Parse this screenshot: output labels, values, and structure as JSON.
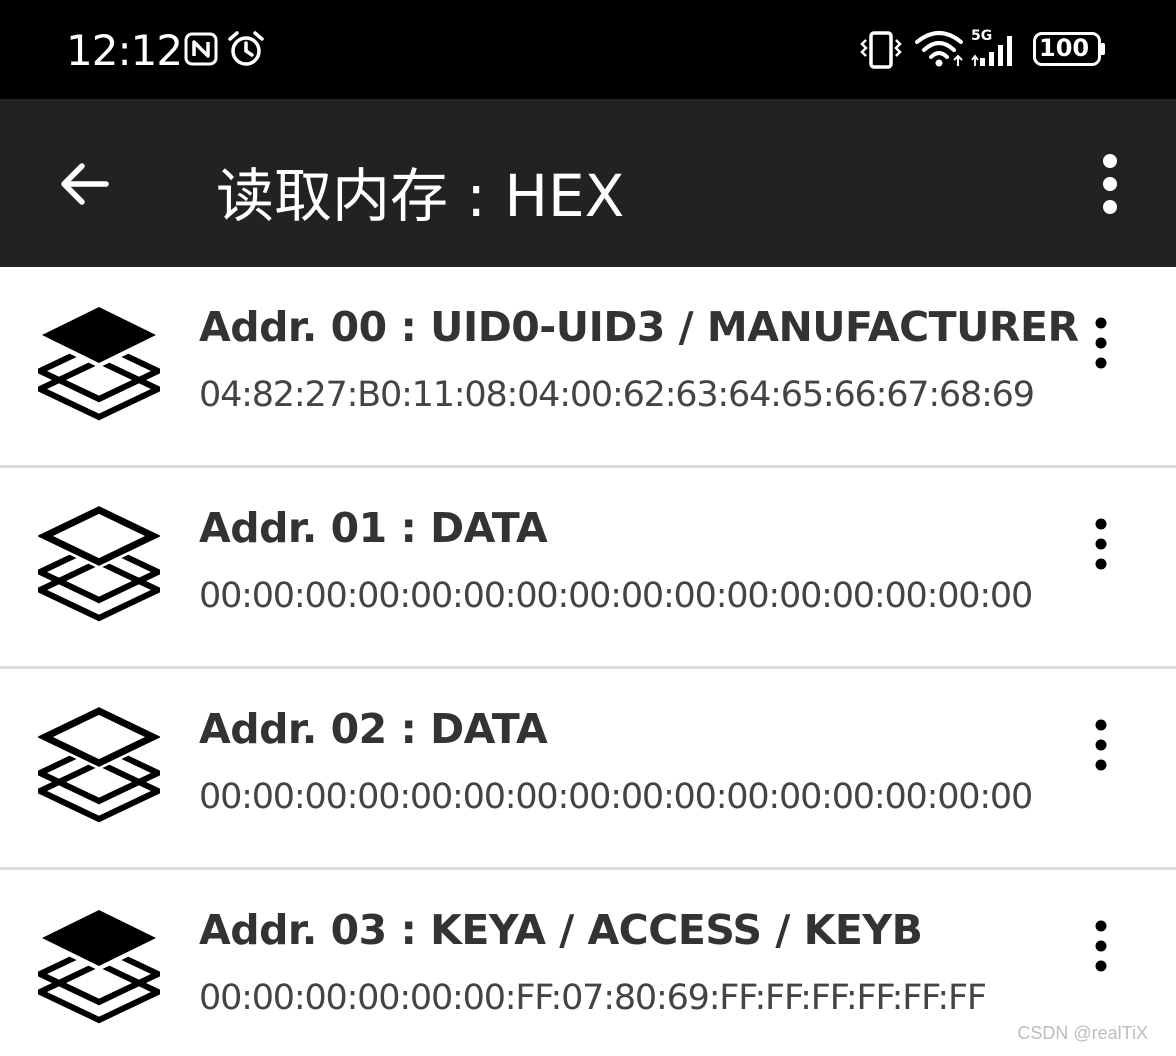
{
  "status_bar": {
    "time": "12:12",
    "left_icons": [
      "nfc-icon",
      "alarm-icon"
    ],
    "right_icons": [
      "vibrate-icon",
      "wifi-icon",
      "cellular-5g-icon",
      "battery-icon"
    ],
    "network_label": "5G",
    "battery_level": "100"
  },
  "app_bar": {
    "title": "读取内存 : HEX",
    "back_icon": "arrow-back-icon",
    "menu_icon": "more-vert-icon"
  },
  "entries": [
    {
      "title": "Addr. 00 : UID0-UID3 / MANUFACTURER",
      "value": "04:82:27:B0:11:08:04:00:62:63:64:65:66:67:68:69",
      "icon": "layers-filled-icon"
    },
    {
      "title": "Addr. 01 : DATA",
      "value": "00:00:00:00:00:00:00:00:00:00:00:00:00:00:00:00",
      "icon": "layers-outline-icon"
    },
    {
      "title": "Addr. 02 : DATA",
      "value": "00:00:00:00:00:00:00:00:00:00:00:00:00:00:00:00",
      "icon": "layers-outline-icon"
    },
    {
      "title": "Addr. 03 : KEYA / ACCESS / KEYB",
      "value": "00:00:00:00:00:00:FF:07:80:69:FF:FF:FF:FF:FF:FF",
      "icon": "layers-filled-icon"
    }
  ],
  "watermark": "CSDN @realTiX",
  "colors": {
    "status_bar": "#000000",
    "app_bar": "#222222",
    "divider": "#dcdcdc",
    "title_text": "#333333"
  }
}
